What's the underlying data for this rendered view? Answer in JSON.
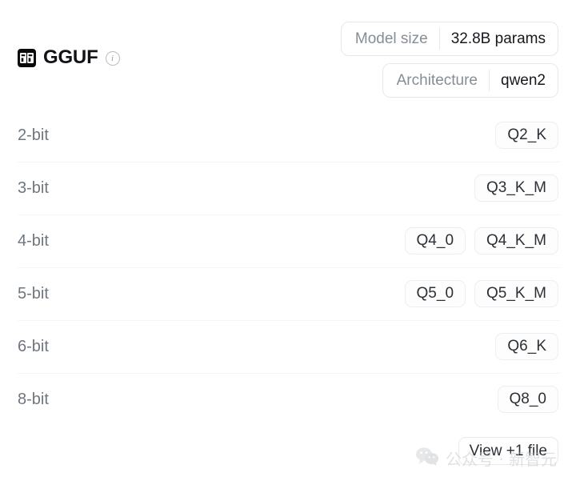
{
  "header": {
    "icon_name": "gguf-format-icon",
    "title": "GGUF",
    "info_glyph": "i"
  },
  "meta": {
    "pills": [
      {
        "key": "Model size",
        "value": "32.8B params"
      },
      {
        "key": "Architecture",
        "value": "qwen2"
      }
    ]
  },
  "quantizations": {
    "rows": [
      {
        "label": "2-bit",
        "tags": [
          "Q2_K"
        ]
      },
      {
        "label": "3-bit",
        "tags": [
          "Q3_K_M"
        ]
      },
      {
        "label": "4-bit",
        "tags": [
          "Q4_0",
          "Q4_K_M"
        ]
      },
      {
        "label": "5-bit",
        "tags": [
          "Q5_0",
          "Q5_K_M"
        ]
      },
      {
        "label": "6-bit",
        "tags": [
          "Q6_K"
        ]
      },
      {
        "label": "8-bit",
        "tags": [
          "Q8_0"
        ]
      }
    ]
  },
  "footer": {
    "view_more_label": "View +1 file"
  },
  "watermark": {
    "logo_name": "wechat-logo",
    "text": "公众号 · 新智元"
  },
  "colors": {
    "background": "#ffffff",
    "title": "#111318",
    "muted_text": "#6f767e",
    "border": "#e7e8ea",
    "divider": "#f4f5f6",
    "icon_background": "#0b0b0d",
    "watermark_text": "#c6cacd"
  }
}
